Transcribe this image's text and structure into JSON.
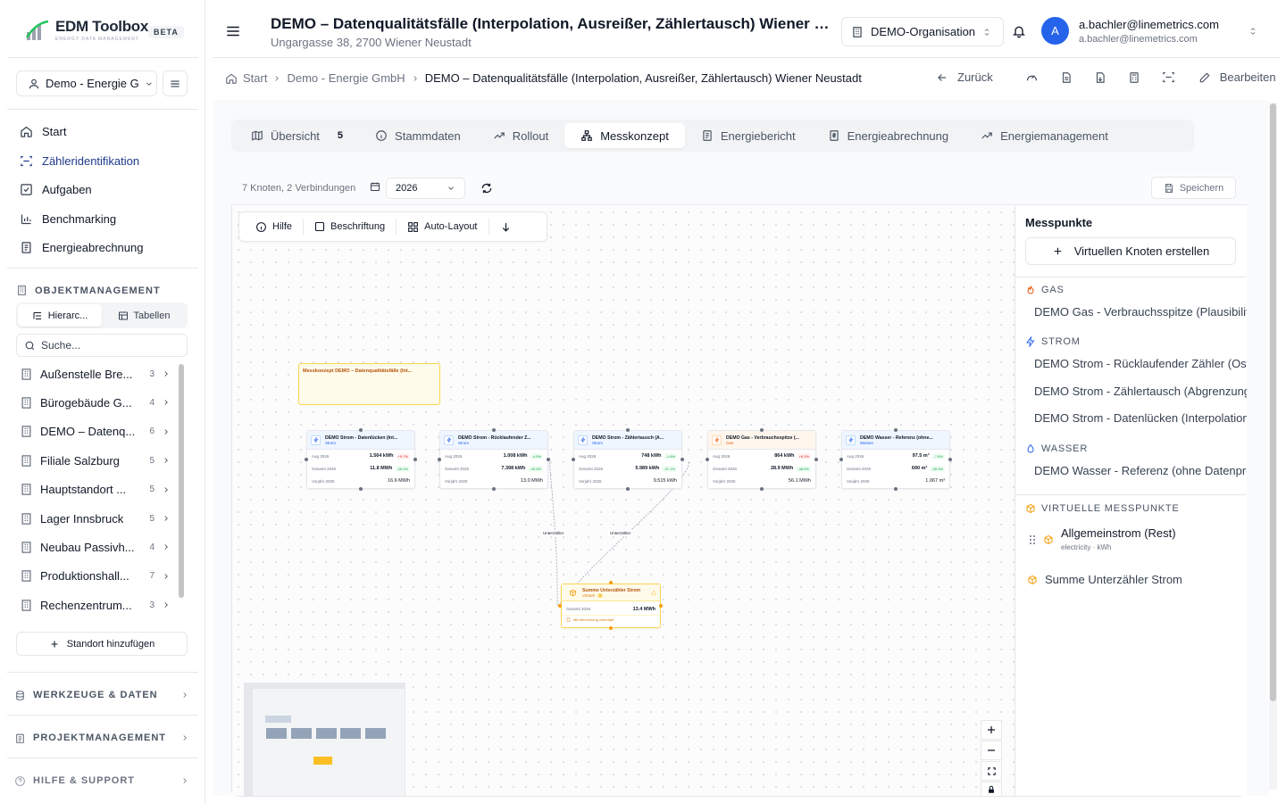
{
  "brand": {
    "title": "EDM Toolbox",
    "subtitle": "ENERGY DATA MANAGEMENT",
    "badge": "BETA"
  },
  "sidebar": {
    "org_select": "Demo - Energie G",
    "nav": [
      {
        "label": "Start",
        "icon": "home-icon"
      },
      {
        "label": "Zähleridentifikation",
        "icon": "scan-icon",
        "active": true
      },
      {
        "label": "Aufgaben",
        "icon": "checkbox-icon"
      },
      {
        "label": "Benchmarking",
        "icon": "bar-chart-icon"
      },
      {
        "label": "Energieabrechnung",
        "icon": "receipt-icon"
      }
    ],
    "object_section": "OBJEKTMANAGEMENT",
    "view_toggle": {
      "hierarchy": "Hierarc...",
      "tables": "Tabellen"
    },
    "search_placeholder": "Suche...",
    "locations": [
      {
        "name": "Außenstelle Bre...",
        "count": "3"
      },
      {
        "name": "Bürogebäude G...",
        "count": "4"
      },
      {
        "name": "DEMO – Datenq...",
        "count": "6"
      },
      {
        "name": "Filiale Salzburg",
        "count": "5"
      },
      {
        "name": "Hauptstandort ...",
        "count": "5"
      },
      {
        "name": "Lager Innsbruck",
        "count": "5"
      },
      {
        "name": "Neubau Passivh...",
        "count": "4"
      },
      {
        "name": "Produktionshall...",
        "count": "7"
      },
      {
        "name": "Rechenzentrum...",
        "count": "3"
      }
    ],
    "add_location": "Standort hinzufügen",
    "sections": [
      "WERKZEUGE & DATEN",
      "PROJEKTMANAGEMENT",
      "HILFE & SUPPORT"
    ]
  },
  "header": {
    "title": "DEMO – Datenqualitätsfälle (Interpolation, Ausreißer, Zählertausch) Wiener Neustadt",
    "address": "Ungargasse 38, 2700 Wiener Neustadt",
    "org_switch": "DEMO-Organisation",
    "user_initial": "A",
    "user_name": "a.bachler@linemetrics.com",
    "user_email": "a.bachler@linemetrics.com"
  },
  "breadcrumb": {
    "items": [
      "Start",
      "Demo - Energie GmbH"
    ],
    "current": "DEMO – Datenqualitätsfälle (Interpolation, Ausreißer, Zählertausch) Wiener Neustadt",
    "back": "Zurück",
    "edit": "Bearbeiten"
  },
  "tabs": [
    {
      "label": "Übersicht",
      "badge": "5",
      "icon": "map-icon"
    },
    {
      "label": "Stammdaten",
      "icon": "info-icon"
    },
    {
      "label": "Rollout",
      "icon": "trend-icon"
    },
    {
      "label": "Messkonzept",
      "icon": "network-icon",
      "active": true
    },
    {
      "label": "Energiebericht",
      "icon": "report-icon"
    },
    {
      "label": "Energieabrechnung",
      "icon": "invoice-icon"
    },
    {
      "label": "Energiemanagement",
      "icon": "trend-icon"
    }
  ],
  "messkonzept": {
    "node_summary": "7 Knoten, 2 Verbindungen",
    "year": "2026",
    "save": "Speichern",
    "tools": {
      "help": "Hilfe",
      "label": "Beschriftung",
      "auto_layout": "Auto-Layout"
    },
    "group_title": "Messkonzept DEMO – Datenqualitätsfälle (Int...",
    "nodes": [
      {
        "title": "DEMO Strom - Datenlücken (Int...",
        "type": "Strom",
        "r1_label": "Aug 2026",
        "r1_val": "1.564 kWh",
        "r1_delta": "+9.7%",
        "r1_dir": "up",
        "r2_label": "Gesamt 2026",
        "r2_val": "11.8 MWh",
        "r2_delta": "-26.0%",
        "r3_label": "Vorjahr 2025",
        "r3_val": "16.6 MWh"
      },
      {
        "title": "DEMO Strom - Rücklaufender Z...",
        "type": "Strom",
        "r1_label": "Aug 2026",
        "r1_val": "1.008 kWh",
        "r1_delta": "-4.5%",
        "r1_dir": "dn",
        "r2_label": "Gesamt 2026",
        "r2_val": "7.398 kWh",
        "r2_delta": "-43.3%",
        "r3_label": "Vorjahr 2025",
        "r3_val": "13.0 MWh"
      },
      {
        "title": "DEMO Strom - Zählertausch (A...",
        "type": "Strom",
        "r1_label": "Aug 2026",
        "r1_val": "748 kWh",
        "r1_delta": "-1.8%",
        "r1_dir": "dn",
        "r2_label": "Gesamt 2026",
        "r2_val": "5.989 kWh",
        "r2_delta": "-37.1%",
        "r3_label": "Vorjahr 2025",
        "r3_val": "9.515 kWh"
      },
      {
        "title": "DEMO Gas - Verbrauchsspitze (...",
        "type": "Gas",
        "r1_label": "Aug 2026",
        "r1_val": "864 kWh",
        "r1_delta": "+6.3%",
        "r1_dir": "up",
        "r2_label": "Gesamt 2026",
        "r2_val": "28.9 MWh",
        "r2_delta": "-48.5%",
        "r3_label": "Vorjahr 2025",
        "r3_val": "56.1 MWh"
      },
      {
        "title": "DEMO Wasser - Referenz (ohne...",
        "type": "Wasser",
        "r1_label": "Aug 2026",
        "r1_val": "97.5 m³",
        "r1_delta": "-7.6%",
        "r1_dir": "dn",
        "r2_label": "Gesamt 2026",
        "r2_val": "690 m³",
        "r2_delta": "-35.3%",
        "r3_label": "Vorjahr 2025",
        "r3_val": "1.067 m³"
      }
    ],
    "edge_label": "Unterzähler",
    "virtual_node": {
      "title": "Summe Unterzähler Strom",
      "type": "Virtuell",
      "badge": "2",
      "r_label": "Gesamt 2026",
      "r_val": "13.4 MWh",
      "note": "Mit Abrechnung verknüpft"
    }
  },
  "measure_points": {
    "title": "Messpunkte",
    "create_virtual": "Virtuellen Knoten erstellen",
    "categories": [
      {
        "name": "GAS",
        "color": "#ea580c",
        "items": [
          "DEMO Gas - Verbrauchsspitze (Plausibilitätsprüfung)"
        ]
      },
      {
        "name": "STROM",
        "color": "#2563eb",
        "items": [
          "DEMO Strom - Rücklaufender Zähler (Ost)",
          "DEMO Strom - Zählertausch (Abgrenzung)",
          "DEMO Strom - Datenlücken (Interpolation)"
        ]
      },
      {
        "name": "WASSER",
        "color": "#2563eb",
        "items": [
          "DEMO Wasser - Referenz (ohne Datenprobleme)"
        ]
      }
    ],
    "virtual_section": "VIRTUELLE MESSPUNKTE",
    "virtual_items": [
      {
        "name": "Allgemeinstrom (Rest)",
        "meta": "electricity · kWh"
      },
      {
        "name": "Summe Unterzähler Strom"
      }
    ]
  }
}
